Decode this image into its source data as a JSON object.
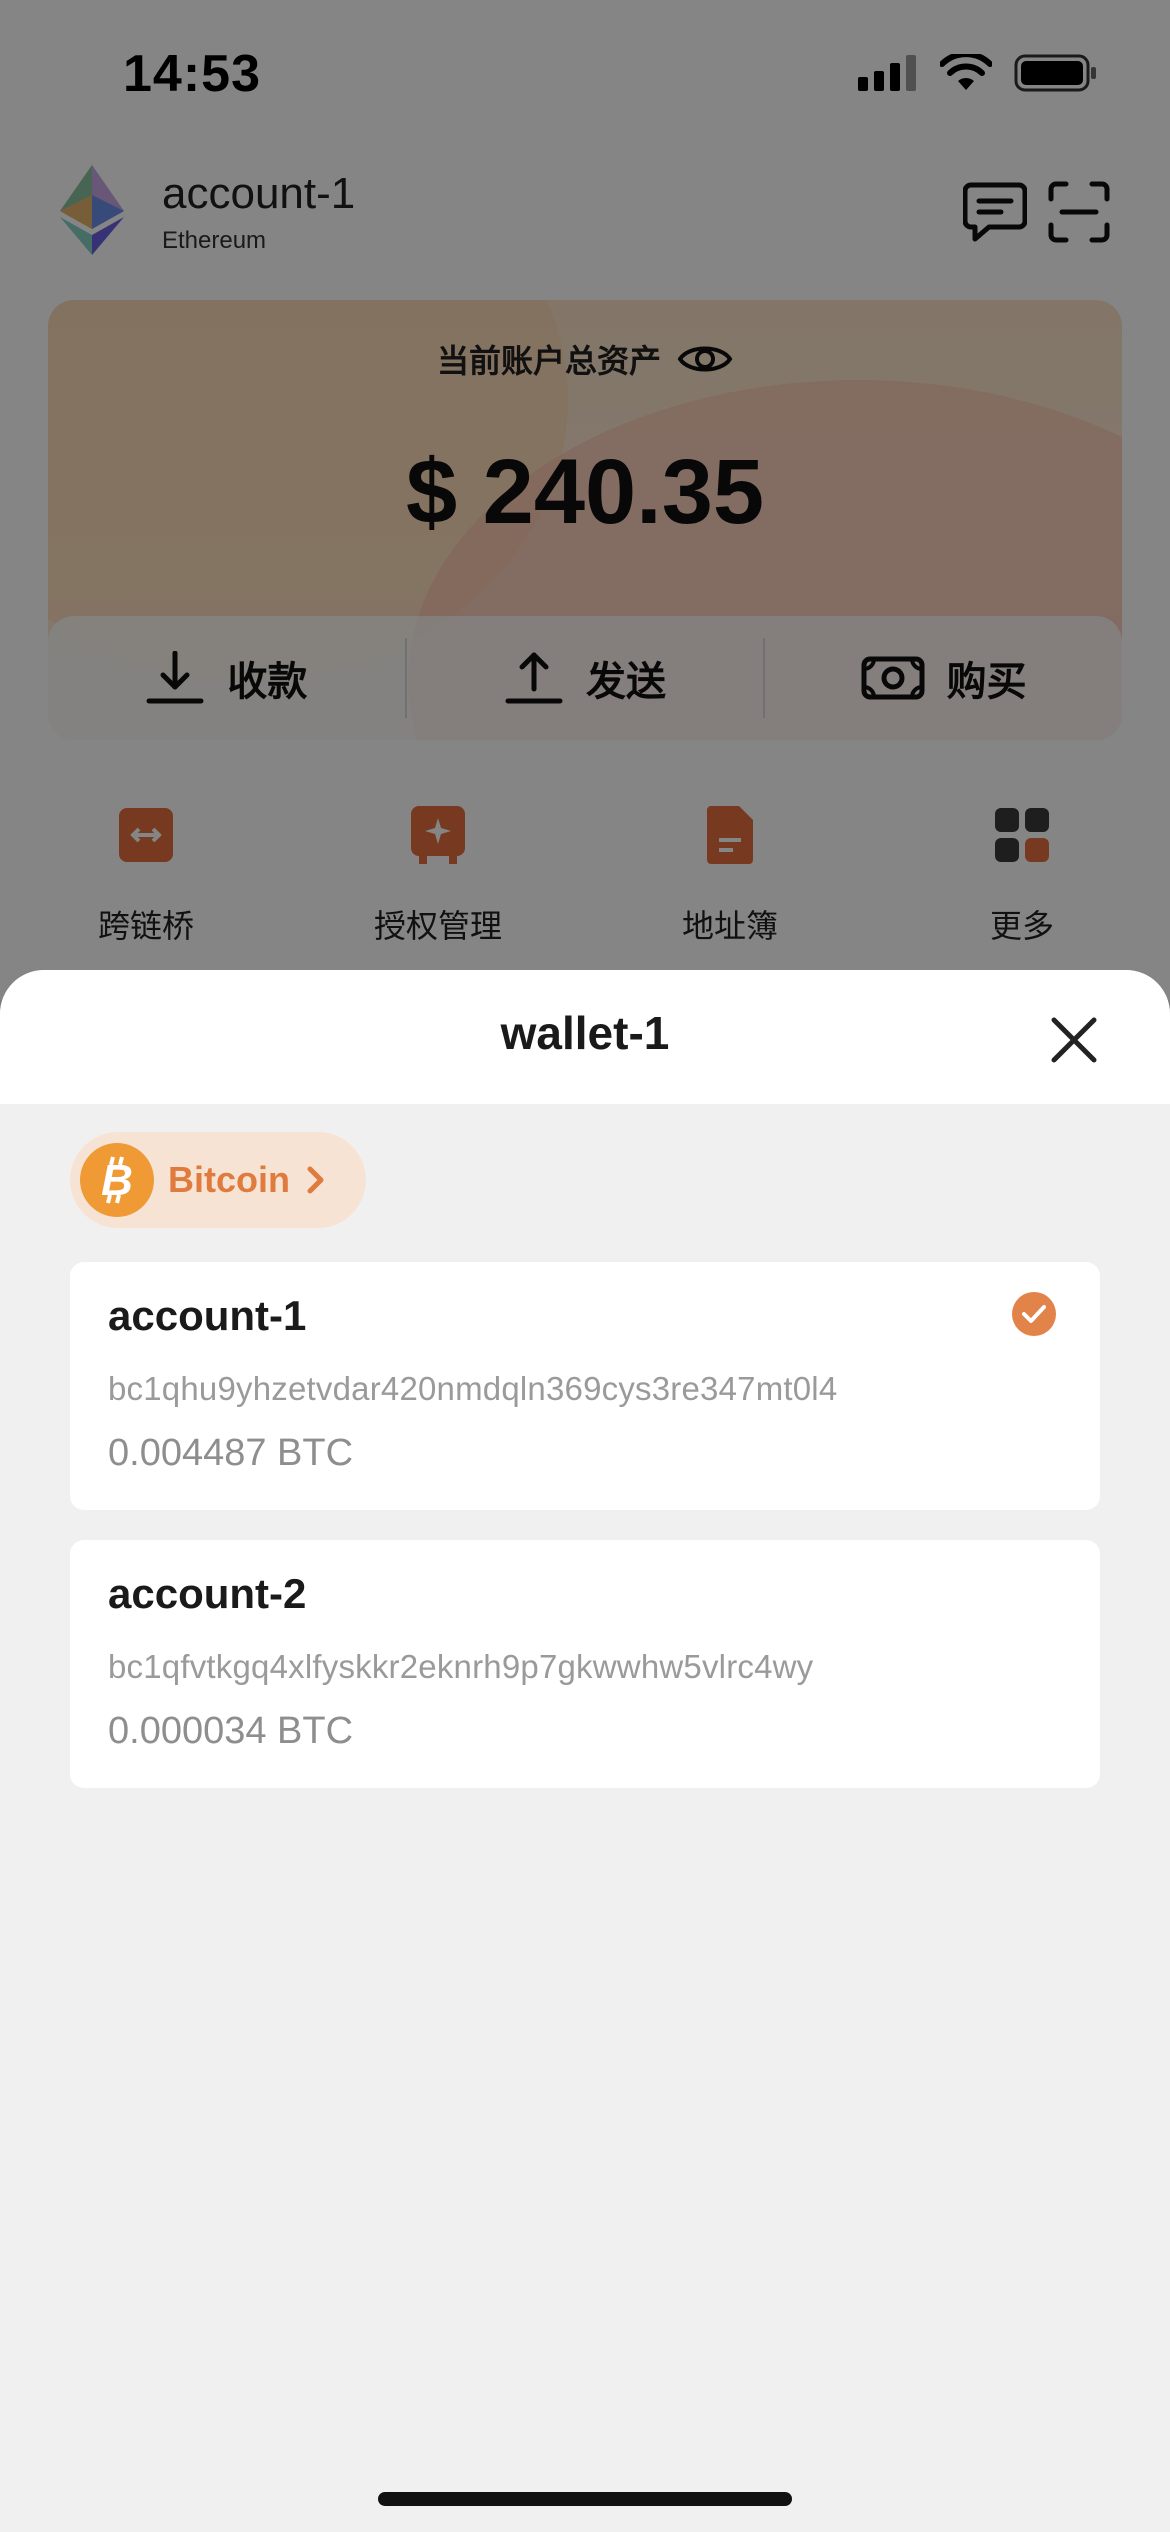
{
  "status_bar": {
    "time": "14:53"
  },
  "header": {
    "account_name": "account-1",
    "chain": "Ethereum"
  },
  "asset_card": {
    "title": "当前账户总资产",
    "total": "$ 240.35",
    "actions": [
      {
        "label": "收款",
        "icon": "download-icon"
      },
      {
        "label": "发送",
        "icon": "upload-icon"
      },
      {
        "label": "购买",
        "icon": "cash-icon"
      }
    ]
  },
  "shortcuts": [
    {
      "label": "跨链桥",
      "icon": "bridge-icon"
    },
    {
      "label": "授权管理",
      "icon": "authorization-icon"
    },
    {
      "label": "地址簿",
      "icon": "address-book-icon"
    },
    {
      "label": "更多",
      "icon": "more-grid-icon"
    }
  ],
  "sheet": {
    "title": "wallet-1",
    "chain_selector": {
      "label": "Bitcoin",
      "icon": "bitcoin-icon"
    },
    "accounts": [
      {
        "name": "account-1",
        "address": "bc1qhu9yhzetvdar420nmdqln369cys3re347mt0l4",
        "balance": "0.004487 BTC",
        "selected": true
      },
      {
        "name": "account-2",
        "address": "bc1qfvtkgq4xlfyskkr2eknrh9p7gkwwhw5vlrc4wy",
        "balance": "0.000034 BTC",
        "selected": false
      }
    ]
  },
  "colors": {
    "accent": "#e2834a",
    "bitcoin": "#f09a35",
    "chip_bg": "#f7e3d4",
    "sheet_bg": "#f0f0f0"
  }
}
